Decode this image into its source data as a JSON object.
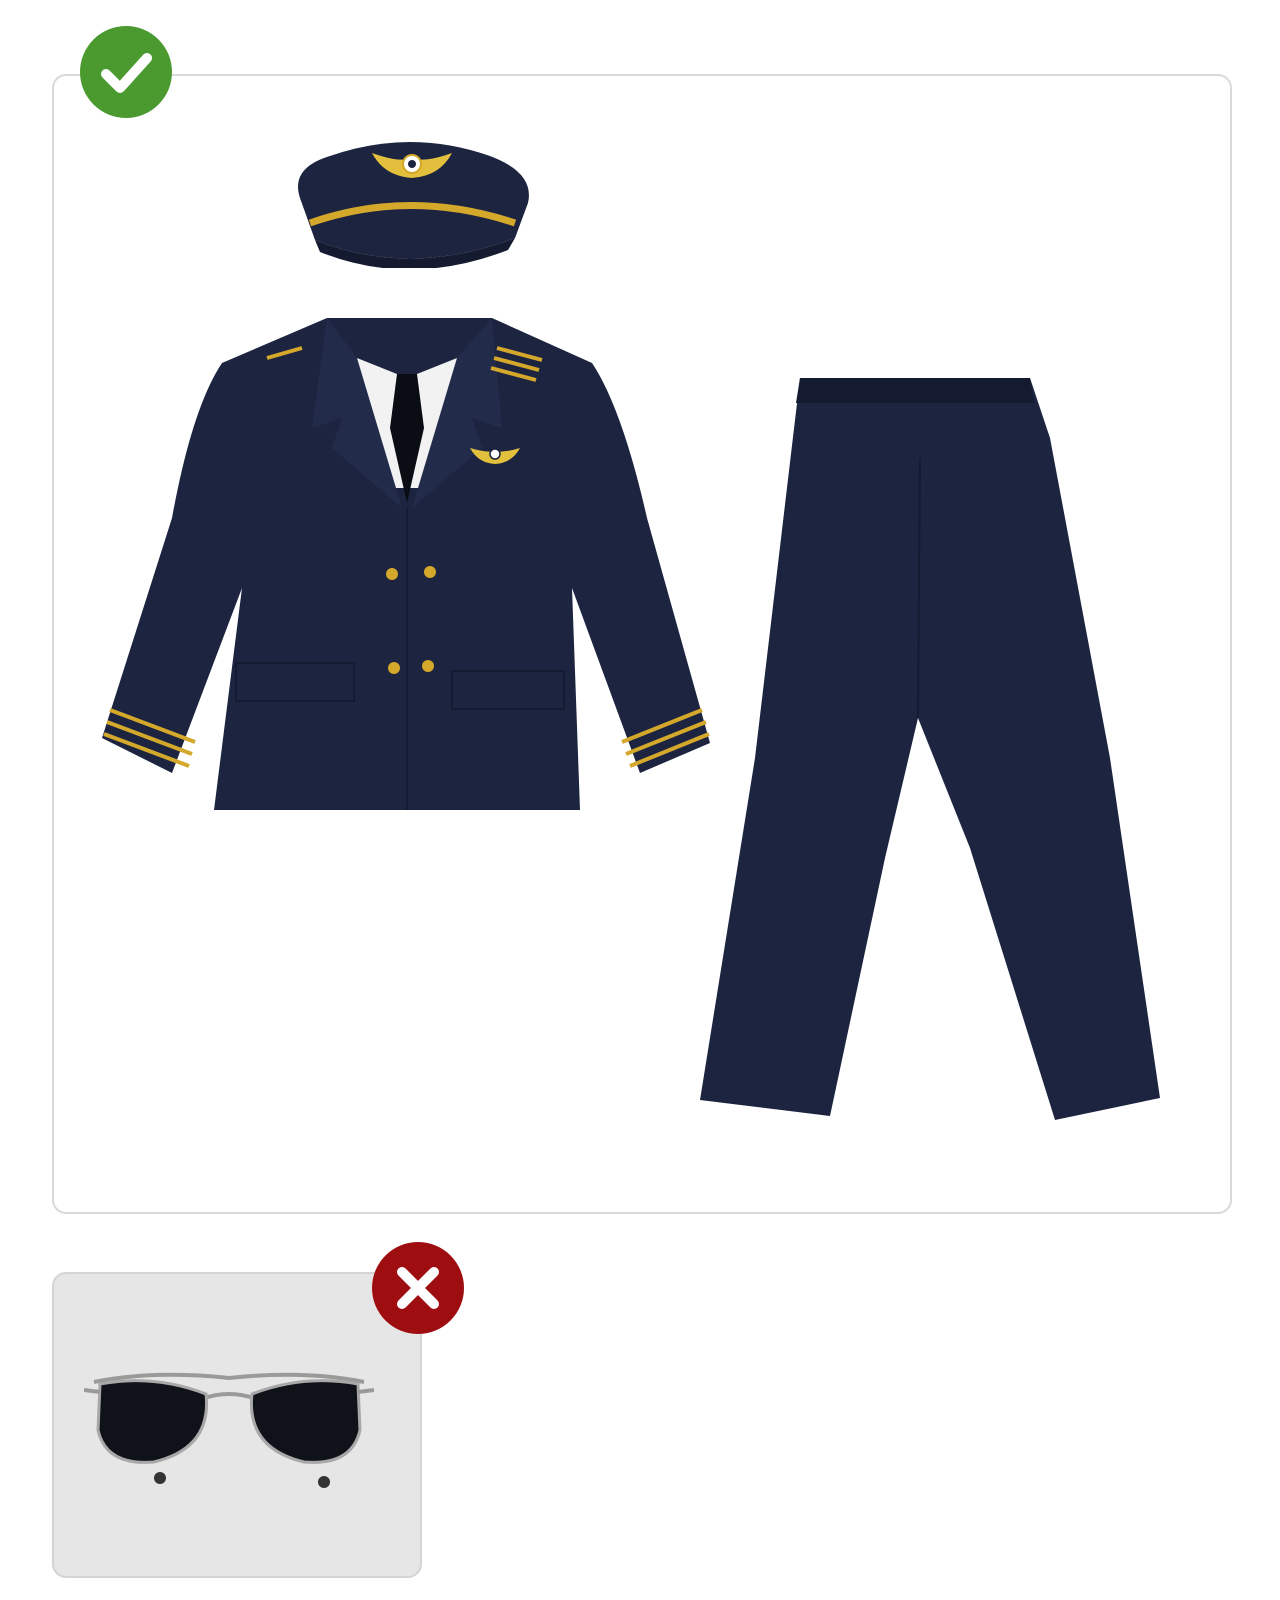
{
  "included": {
    "status": "included",
    "icon": "checkmark-icon",
    "color": "#4a9a2f",
    "items": [
      {
        "name": "pilot-hat",
        "icon": "pilot-hat-icon"
      },
      {
        "name": "pilot-jacket",
        "icon": "pilot-jacket-icon"
      },
      {
        "name": "pilot-pants",
        "icon": "pilot-pants-icon"
      }
    ]
  },
  "excluded": {
    "status": "not-included",
    "icon": "cross-icon",
    "color": "#9e0d10",
    "items": [
      {
        "name": "aviator-sunglasses",
        "icon": "aviator-sunglasses-icon"
      }
    ]
  },
  "colors": {
    "navy": "#1c2440",
    "gold": "#d4a82a",
    "panel_border": "#d9d9d9",
    "excluded_background": "#e6e6e6"
  }
}
